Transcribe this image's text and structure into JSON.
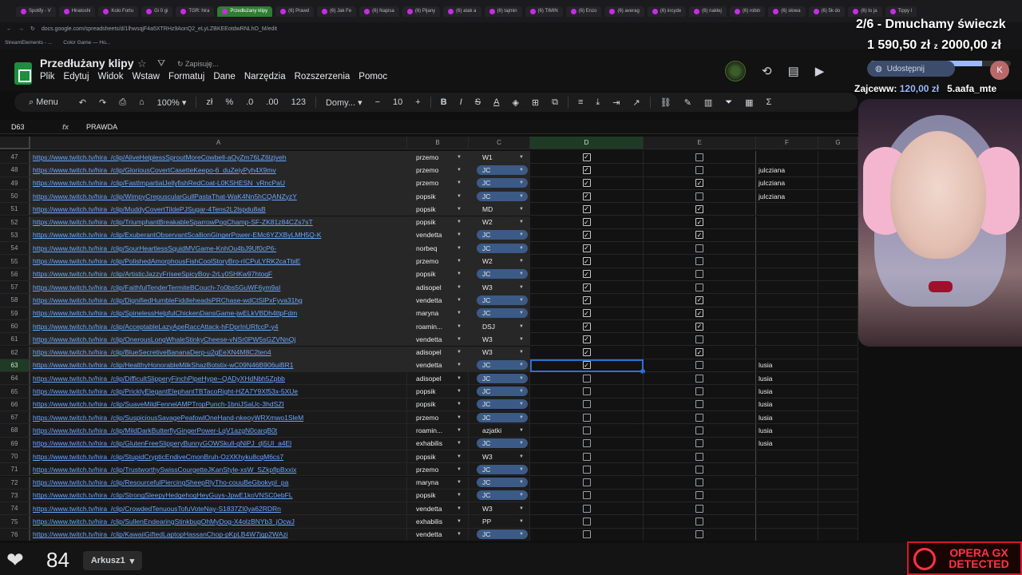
{
  "browser": {
    "tabs": [
      "Spotify - V",
      "Hiratoshi",
      "Kolo Fortu",
      "Gi 0 gi",
      "TGR: hira",
      "Przedłużany klipy",
      "(6) Prawd",
      "(6) Jak Fe",
      "(6) Napisa",
      "(6) Pijany",
      "(6) atak a",
      "(6) tajmin",
      "(6) TIMIN",
      "(6) Enzo",
      "(6) averag",
      "(6) incyde",
      "(6) naklej",
      "(6) robin",
      "(6) słowa",
      "(6) 5k do",
      "(6) to ja",
      "Tippy l"
    ],
    "active_tab": "Przedłużany klipy",
    "url": "docs.google.com/spreadsheets/d/1lhwsqjF4a5XTRHz9AonQ2_eLyLZBKEEotdwRNLhO_M/edit",
    "bookmarks": [
      "StreamElements - ...",
      "Color Game — Ho..."
    ]
  },
  "doc": {
    "title": "Przedłużany klipy",
    "saving": "Zapisuję...",
    "menu": [
      "Plik",
      "Edytuj",
      "Widok",
      "Wstaw",
      "Formatuj",
      "Dane",
      "Narzędzia",
      "Rozszerzenia",
      "Pomoc"
    ]
  },
  "toolbar": {
    "menu_label": "Menu",
    "zoom": "100%",
    "currency": "zł",
    "percent": "%",
    "dec_less": ".0",
    "dec_more": ".00",
    "num_format": "123",
    "font": "Domy...",
    "minus": "−",
    "font_size": "10",
    "plus": "+",
    "bold": "B",
    "italic": "I",
    "strike": "S",
    "text_color": "A"
  },
  "formula_bar": {
    "cell_ref": "D63",
    "value": "PRAWDA"
  },
  "columns": [
    "A",
    "B",
    "C",
    "D",
    "E",
    "F",
    "G"
  ],
  "selected_column": "D",
  "rows": [
    {
      "n": "47",
      "url": "https://www.twitch.tv/hira_/clip/AliveHelplessSproutMoreCowbell-aOyZm76LZ6lzjveh",
      "b": "przemo",
      "c": "W1",
      "d": true,
      "e": false,
      "f": ""
    },
    {
      "n": "48",
      "url": "https://www.twitch.tv/hira_/clip/GloriousCovertCasetteKeepo-6_duZeiyPyh4X9mv",
      "b": "przemo",
      "c": "JC",
      "d": true,
      "e": false,
      "f": "julcziana"
    },
    {
      "n": "49",
      "url": "https://www.twitch.tv/hira_/clip/FastImpartialJellyfishRedCoat-L0KSHESN_vRncPaU",
      "b": "przemo",
      "c": "JC",
      "d": true,
      "e": true,
      "f": "julcziana"
    },
    {
      "n": "50",
      "url": "https://www.twitch.tv/hira_/clip/WimpyCrepuscularGullPastaThat-WaK4Nn5hCQANZyzY",
      "b": "popsik",
      "c": "JC",
      "d": true,
      "e": false,
      "f": "julcziana"
    },
    {
      "n": "51",
      "url": "https://www.twitch.tv/hira_/clip/MuddyCovertTildePJSugar-4Tens2L2lspdu8aB",
      "b": "popsik",
      "c": "MD",
      "d": true,
      "e": true,
      "f": ""
    },
    {
      "n": "52",
      "url": "https://www.twitch.tv/hira_/clip/TriumphantBreakableSparrowPogChamp-SF-ZK81z84CZs7sT",
      "b": "popsik",
      "c": "W2",
      "d": true,
      "e": true,
      "f": ""
    },
    {
      "n": "53",
      "url": "https://www.twitch.tv/hira_/clip/ExuberantObservantScallionGingerPower-EMc6YZXByLMH5Q-K",
      "b": "vendetta",
      "c": "JC",
      "d": true,
      "e": true,
      "f": ""
    },
    {
      "n": "54",
      "url": "https://www.twitch.tv/hira_/clip/SourHeartlessSquidMVGame-KnhOu4bJ9Uf0cP6-",
      "b": "norbeq",
      "c": "JC",
      "d": true,
      "e": false,
      "f": ""
    },
    {
      "n": "55",
      "url": "https://www.twitch.tv/hira_/clip/PolishedAmorphousFishCoolStoryBro-rICPuLYRK2caTbiE",
      "b": "przemo",
      "c": "W2",
      "d": true,
      "e": false,
      "f": ""
    },
    {
      "n": "56",
      "url": "https://www.twitch.tv/hira_/clip/ArtisticJazzyFriseeSpicyBoy-2rLy0SHKw97htoqF",
      "b": "popsik",
      "c": "JC",
      "d": true,
      "e": false,
      "f": ""
    },
    {
      "n": "57",
      "url": "https://www.twitch.tv/hira_/clip/FaithfulTenderTermiteBCouch-7o0bs5GuWF6ym9aI",
      "b": "adisopel",
      "c": "W3",
      "d": true,
      "e": false,
      "f": ""
    },
    {
      "n": "58",
      "url": "https://www.twitch.tv/hira_/clip/DignifiedHumbleFiddleheadsPRChase-wdCtSIPxFyva31hg",
      "b": "vendetta",
      "c": "JC",
      "d": true,
      "e": true,
      "f": ""
    },
    {
      "n": "59",
      "url": "https://www.twitch.tv/hira_/clip/SpinelessHelpfulChickenDansGame-jwELkVBDh4ttpFdm",
      "b": "maryna",
      "c": "JC",
      "d": true,
      "e": true,
      "f": ""
    },
    {
      "n": "60",
      "url": "https://www.twitch.tv/hira_/clip/AcceptableLazyApeRaccAttack-hFDprInURfccP-y4",
      "b": "roamin...",
      "c": "DSJ",
      "d": true,
      "e": true,
      "f": ""
    },
    {
      "n": "61",
      "url": "https://www.twitch.tv/hira_/clip/OnerousLongWhaleStinkyCheese-vNSr0PW5sGZVNnQj",
      "b": "vendetta",
      "c": "W3",
      "d": true,
      "e": false,
      "f": ""
    },
    {
      "n": "62",
      "url": "https://www.twitch.tv/hira_/clip/BlueSecretiveBananaDerp-u2gEeXN4M8C2ten4",
      "b": "adisopel",
      "c": "W3",
      "d": true,
      "e": true,
      "f": ""
    },
    {
      "n": "63",
      "url": "https://www.twitch.tv/hira_/clip/HealthyHonorableMilkShazBotstix-wC09N46B906uiBR1",
      "b": "vendetta",
      "c": "JC",
      "d": true,
      "e": false,
      "f": "lusia"
    },
    {
      "n": "64",
      "url": "https://www.twitch.tv/hira_/clip/DifficultSlipperyFinchPipeHype--QADyXHdNbh5Zpbb",
      "b": "adisopel",
      "c": "JC",
      "d": false,
      "e": false,
      "f": "lusia"
    },
    {
      "n": "65",
      "url": "https://www.twitch.tv/hira_/clip/PricklyElegantElephantTBTacoRight-HZA7Y9Xf53x-5XUe",
      "b": "popsik",
      "c": "JC",
      "d": false,
      "e": false,
      "f": "lusia"
    },
    {
      "n": "66",
      "url": "https://www.twitch.tv/hira_/clip/SuaveMildFennelAMPTropPunch-1bniJSaUc-3hdSZI",
      "b": "popsik",
      "c": "JC",
      "d": false,
      "e": false,
      "f": "lusia"
    },
    {
      "n": "67",
      "url": "https://www.twitch.tv/hira_/clip/SuspiciousSavagePeafowlOneHand-nkeoyWRXmwo1SleM",
      "b": "przemo",
      "c": "JC",
      "d": false,
      "e": false,
      "f": "lusia"
    },
    {
      "n": "68",
      "url": "https://www.twitch.tv/hira_/clip/MildDarkButterflyGingerPower-LqV1azgN0carqB0t",
      "b": "roamin...",
      "c": "azjatki",
      "d": false,
      "e": false,
      "f": "lusia"
    },
    {
      "n": "69",
      "url": "https://www.twitch.tv/hira_/clip/GlutenFreeSlipperyBunnyGOWSkull-gNiPJ_dj5UI_a4El",
      "b": "exhabilis",
      "c": "JC",
      "d": false,
      "e": false,
      "f": "lusia"
    },
    {
      "n": "70",
      "url": "https://www.twitch.tv/hira_/clip/StupidCrypticEndiveCmonBruh-OzXKhyku8cqM6cs7",
      "b": "popsik",
      "c": "W3",
      "d": false,
      "e": false,
      "f": ""
    },
    {
      "n": "71",
      "url": "https://www.twitch.tv/hira_/clip/TrustworthySwissCourgetteJKanStyle-xsW_SZkpflpBxxix",
      "b": "przemo",
      "c": "JC",
      "d": false,
      "e": false,
      "f": ""
    },
    {
      "n": "72",
      "url": "https://www.twitch.tv/hira_/clip/ResourcefulPiercingSheepRlyTho-couuBeGbokvpI_pa",
      "b": "maryna",
      "c": "JC",
      "d": false,
      "e": false,
      "f": ""
    },
    {
      "n": "73",
      "url": "https://www.twitch.tv/hira_/clip/StrongSleepyHedgehogHeyGuys-JpwE1koVNSC0ebFL",
      "b": "popsik",
      "c": "JC",
      "d": false,
      "e": false,
      "f": ""
    },
    {
      "n": "74",
      "url": "https://www.twitch.tv/hira_/clip/CrowdedTenuousTofuVoteNay-S1837ZI0ya62RDRn",
      "b": "vendetta",
      "c": "W3",
      "d": false,
      "e": false,
      "f": ""
    },
    {
      "n": "75",
      "url": "https://www.twitch.tv/hira_/clip/SullenEndearingStinkbugOhMyDog-X4olzBNYb3_jOcwJ",
      "b": "exhabilis",
      "c": "PP",
      "d": false,
      "e": false,
      "f": ""
    },
    {
      "n": "76",
      "url": "https://www.twitch.tv/hira_/clip/KawaiiGiftedLaptopHassanChop-pKpLB4W7jgp2WAzi",
      "b": "vendetta",
      "c": "JC",
      "d": false,
      "e": false,
      "f": ""
    }
  ],
  "active_row": "63",
  "sheet_tab": "Arkusz1",
  "overlay": {
    "goal_title": "2/6 - Dmuchamy świeczk",
    "goal_current": "1 590,50 zł",
    "goal_sep": "z",
    "goal_target": "2000,00 zł",
    "goal_progress": 0.795,
    "share_label": "Udostępnij",
    "avatar_letter": "K",
    "ticker_name": "Zajcew",
    "ticker_sep": "w:",
    "ticker_amount": "120,00 zł",
    "ticker_next": "5.aafa_mte",
    "hp_value": "84",
    "opera_text": "OPERA GX DETECTED"
  },
  "colors": {
    "link": "#6aa7ff",
    "jc_chip": "#3b5a85",
    "selection": "#2f6fd6",
    "opera_red": "#ff3344"
  }
}
